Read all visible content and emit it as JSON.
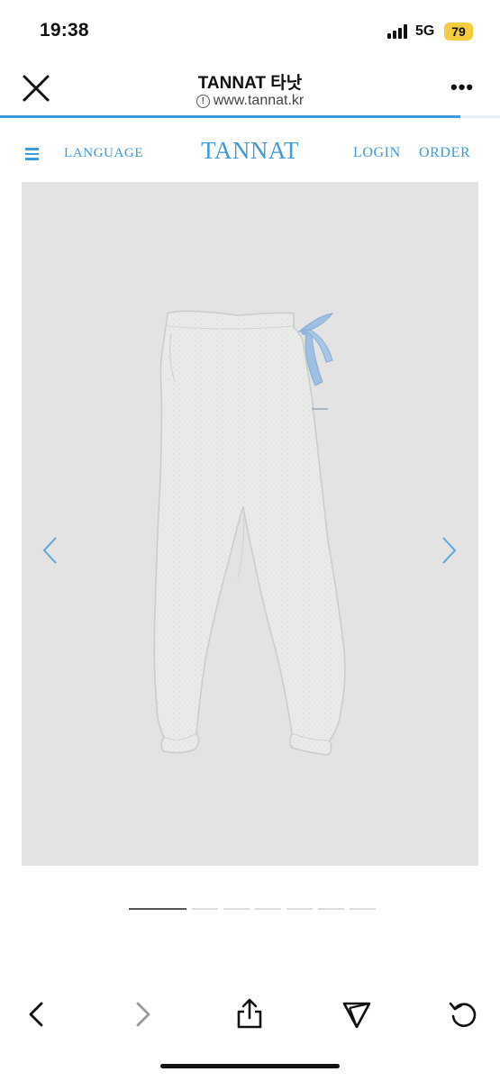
{
  "status_bar": {
    "time": "19:38",
    "network": "5G",
    "battery": "79"
  },
  "browser": {
    "title": "TANNAT 타낫",
    "url": "www.tannat.kr",
    "info_symbol": "!",
    "page_load_progress": 0.92,
    "icons": {
      "close": "close-icon",
      "more": "more-icon"
    }
  },
  "site_nav": {
    "language_label": "LANGUAGE",
    "logo_text": "TANNAT",
    "login_label": "LOGIN",
    "order_label": "ORDER",
    "accent_color": "#3f9ad8",
    "icons": {
      "menu": "hamburger-icon"
    }
  },
  "product_gallery": {
    "subject": "light gray sweatpants with blue ribbon tie",
    "image_count": 7,
    "active_index": 0,
    "icons": {
      "previous": "chevron-left-icon",
      "next": "chevron-right-icon"
    }
  },
  "toolbar": {
    "icons": [
      "back-icon",
      "forward-icon",
      "share-icon",
      "send-icon",
      "reload-icon"
    ]
  }
}
